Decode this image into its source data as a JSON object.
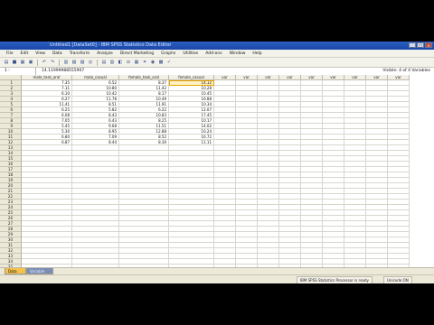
{
  "window": {
    "title": "Untitled1 [DataSet0] - IBM SPSS Statistics Data Editor",
    "controls": [
      "_",
      "□",
      "×"
    ]
  },
  "menu": [
    "File",
    "Edit",
    "View",
    "Data",
    "Transform",
    "Analyze",
    "Direct Marketing",
    "Graphs",
    "Utilities",
    "Add-ons",
    "Window",
    "Help"
  ],
  "toolbar_icons": [
    "open-icon",
    "save-icon",
    "print-icon",
    "dialog-recall-icon",
    "undo-icon",
    "redo-icon",
    "goto-case-icon",
    "goto-variable-icon",
    "variables-icon",
    "find-icon",
    "insert-cases-icon",
    "insert-variable-icon",
    "split-file-icon",
    "weight-cases-icon",
    "select-cases-icon",
    "value-labels-icon",
    "use-sets-icon",
    "show-all-icon",
    "spelling-icon"
  ],
  "cell_editor": {
    "reference": "1 : female_casual",
    "value": "14.11999988555907",
    "visible": "Visible: 4 of 4 Variables"
  },
  "columns": [
    "male_task_oral",
    "male_casual",
    "female_task_oral",
    "female_casual",
    "var",
    "var",
    "var",
    "var",
    "var",
    "var",
    "var",
    "var",
    "var"
  ],
  "rows": [
    [
      "7.35",
      "6.52",
      "8.37",
      "14.12"
    ],
    [
      "7.11",
      "10.80",
      "11.42",
      "10.28"
    ],
    [
      "6.10",
      "10.42",
      "8.17",
      "10.45"
    ],
    [
      "6.27",
      "11.78",
      "10.49",
      "16.88"
    ],
    [
      "11.41",
      "8.51",
      "11.91",
      "10.34"
    ],
    [
      "6.25",
      "5.82",
      "6.22",
      "12.07"
    ],
    [
      "6.08",
      "8.43",
      "10.83",
      "17.45"
    ],
    [
      "7.05",
      "6.43",
      "8.25",
      "10.17"
    ],
    [
      "5.45",
      "9.68",
      "11.51",
      "14.02"
    ],
    [
      "5.30",
      "8.95",
      "12.88",
      "10.24"
    ],
    [
      "6.80",
      "7.09",
      "8.52",
      "16.72"
    ],
    [
      "6.87",
      "8.44",
      "8.30",
      "11.11"
    ]
  ],
  "total_rows": 37,
  "selected_cell": {
    "row": 1,
    "column": "female_casual"
  },
  "tabs": {
    "active": "Data View",
    "inactive": "Variable View"
  },
  "status": {
    "processor": "IBM SPSS Statistics Processor is ready",
    "unicode": "Unicode:ON"
  }
}
